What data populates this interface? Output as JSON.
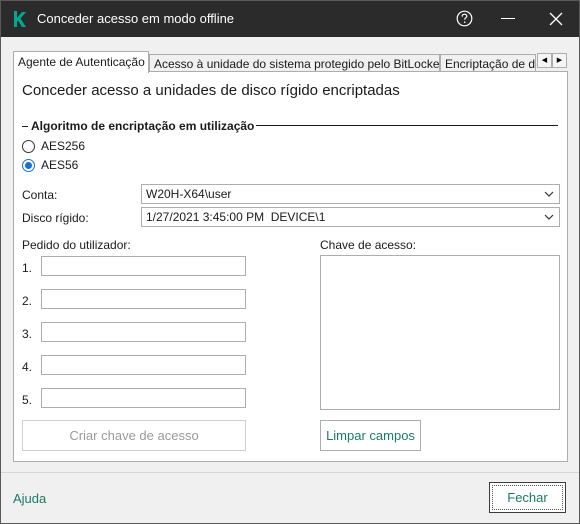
{
  "window": {
    "title": "Conceder acesso em modo offline",
    "icons": {
      "logo": "kaspersky-k-logo",
      "help": "question-circle-icon",
      "minimize": "minimize-icon",
      "close": "close-icon"
    }
  },
  "tabs": [
    {
      "label": "Agente de Autenticação",
      "active": true
    },
    {
      "label": "Acesso à unidade do sistema protegido pelo BitLocker",
      "active": false
    },
    {
      "label": "Encriptação de dados",
      "active": false
    }
  ],
  "tab_scroll": {
    "left": "◀",
    "right": "▶"
  },
  "panel": {
    "heading": "Conceder acesso a unidades de disco rígido encriptadas",
    "algorithm_group": {
      "title": "Algoritmo de encriptação em utilização",
      "options": [
        {
          "label": "AES256",
          "checked": false
        },
        {
          "label": "AES56",
          "checked": true
        }
      ]
    },
    "account": {
      "label": "Conta:",
      "value": "W20H-X64\\user"
    },
    "disk": {
      "label": "Disco rígido:",
      "value": "1/27/2021 3:45:00 PM  DEVICE\\1"
    },
    "user_request": {
      "label": "Pedido do utilizador:",
      "fields": [
        {
          "number": "1.",
          "value": ""
        },
        {
          "number": "2.",
          "value": ""
        },
        {
          "number": "3.",
          "value": ""
        },
        {
          "number": "4.",
          "value": ""
        },
        {
          "number": "5.",
          "value": ""
        }
      ]
    },
    "access_key": {
      "label": "Chave de acesso:",
      "value": ""
    },
    "create_key_button": "Criar chave de acesso",
    "clear_fields_button": "Limpar campos"
  },
  "footer": {
    "help_link": "Ajuda",
    "close_button": "Fechar"
  },
  "colors": {
    "titlebar": "#2b2b2b",
    "accent_link": "#1a7a6a",
    "radio_checked": "#1a6fd0",
    "logo_green": "#00a88e"
  }
}
